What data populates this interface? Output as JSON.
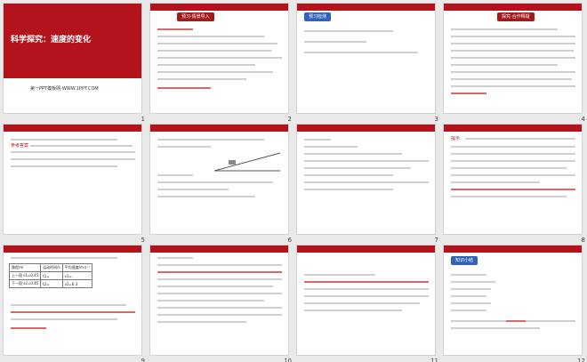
{
  "slides": [
    {
      "num": "1",
      "title": "科学探究：速度的变化",
      "subtitle": "第一PPT模板网-WWW.1PPT.COM"
    },
    {
      "num": "2",
      "header": "预习·情景导入"
    },
    {
      "num": "3",
      "header": "预习检测"
    },
    {
      "num": "4",
      "header": "探究·合作释疑"
    },
    {
      "num": "5",
      "label": "参考答案"
    },
    {
      "num": "6"
    },
    {
      "num": "7"
    },
    {
      "num": "8",
      "label": "提示"
    },
    {
      "num": "9",
      "table_head": [
        "路程/m",
        "运动时间/s",
        "平均速度/m·s⁻¹"
      ],
      "rows": [
        [
          "上一段 s1=0.45",
          "t1=",
          "v1="
        ],
        [
          "下一段 s2=0.45",
          "t2=",
          "v2=0.3"
        ]
      ]
    },
    {
      "num": "10"
    },
    {
      "num": "11"
    },
    {
      "num": "12",
      "header": "知识小结"
    }
  ]
}
